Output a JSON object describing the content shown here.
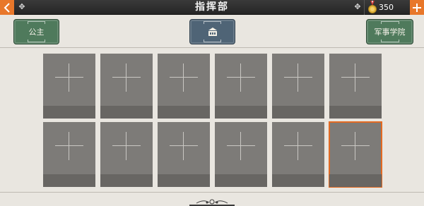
{
  "header": {
    "title": "指挥部",
    "currency_value": "350"
  },
  "nav": {
    "princess_label": "公主",
    "academy_label": "军事学院"
  },
  "slots": {
    "rows": 2,
    "cols": 6,
    "selected_index": 11
  },
  "colors": {
    "accent": "#e8772a",
    "green_button": "#4f7a5c",
    "blue_button": "#4f6476",
    "slot": "#7d7b78"
  }
}
